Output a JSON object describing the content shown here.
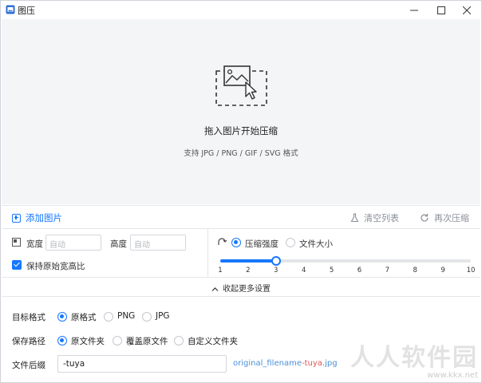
{
  "window": {
    "title": "图压",
    "minimize_glyph": "—",
    "maximize_glyph": "☐",
    "close_glyph": "✕"
  },
  "drop_zone": {
    "icon": "image-select-icon",
    "title": "拖入图片开始压缩",
    "subtitle": "支持 JPG / PNG / GIF / SVG 格式"
  },
  "toolbar": {
    "add_label": "添加图片",
    "clear_label": "清空列表",
    "recompress_label": "再次压缩",
    "accent": "#1677ff",
    "muted": "#8a8f98"
  },
  "resize": {
    "width_label": "宽度",
    "width_placeholder": "自动",
    "height_label": "高度",
    "height_placeholder": "自动",
    "keep_ratio_label": "保持原始宽高比",
    "keep_ratio_checked": true
  },
  "compression": {
    "mode_options": [
      "压缩强度",
      "文件大小"
    ],
    "selected_mode": "压缩强度",
    "ticks": [
      "1",
      "2",
      "3",
      "4",
      "5",
      "6",
      "7",
      "8",
      "9",
      "10"
    ],
    "min": 1,
    "max": 10,
    "value": 3
  },
  "collapse_label": "收起更多设置",
  "format": {
    "label": "目标格式",
    "options": [
      "原格式",
      "PNG",
      "JPG"
    ],
    "selected": "原格式"
  },
  "save_path": {
    "label": "保存路径",
    "options": [
      "原文件夹",
      "覆盖原文件",
      "自定义文件夹"
    ],
    "selected": "原文件夹"
  },
  "suffix": {
    "label": "文件后缀",
    "value": "-tuya",
    "preview_prefix": "original_filename",
    "preview_suffix": "-tuya",
    "preview_ext": ".jpg"
  },
  "watermark": {
    "text": "人人软件园",
    "url": "www.kkx.net"
  }
}
